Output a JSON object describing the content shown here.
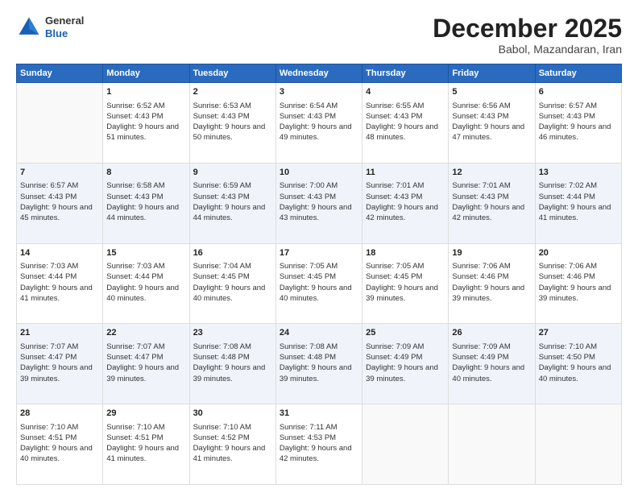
{
  "header": {
    "logo_line1": "General",
    "logo_line2": "Blue",
    "month": "December 2025",
    "location": "Babol, Mazandaran, Iran"
  },
  "weekdays": [
    "Sunday",
    "Monday",
    "Tuesday",
    "Wednesday",
    "Thursday",
    "Friday",
    "Saturday"
  ],
  "weeks": [
    [
      {
        "day": "",
        "sunrise": "",
        "sunset": "",
        "daylight": ""
      },
      {
        "day": "1",
        "sunrise": "Sunrise: 6:52 AM",
        "sunset": "Sunset: 4:43 PM",
        "daylight": "Daylight: 9 hours and 51 minutes."
      },
      {
        "day": "2",
        "sunrise": "Sunrise: 6:53 AM",
        "sunset": "Sunset: 4:43 PM",
        "daylight": "Daylight: 9 hours and 50 minutes."
      },
      {
        "day": "3",
        "sunrise": "Sunrise: 6:54 AM",
        "sunset": "Sunset: 4:43 PM",
        "daylight": "Daylight: 9 hours and 49 minutes."
      },
      {
        "day": "4",
        "sunrise": "Sunrise: 6:55 AM",
        "sunset": "Sunset: 4:43 PM",
        "daylight": "Daylight: 9 hours and 48 minutes."
      },
      {
        "day": "5",
        "sunrise": "Sunrise: 6:56 AM",
        "sunset": "Sunset: 4:43 PM",
        "daylight": "Daylight: 9 hours and 47 minutes."
      },
      {
        "day": "6",
        "sunrise": "Sunrise: 6:57 AM",
        "sunset": "Sunset: 4:43 PM",
        "daylight": "Daylight: 9 hours and 46 minutes."
      }
    ],
    [
      {
        "day": "7",
        "sunrise": "Sunrise: 6:57 AM",
        "sunset": "Sunset: 4:43 PM",
        "daylight": "Daylight: 9 hours and 45 minutes."
      },
      {
        "day": "8",
        "sunrise": "Sunrise: 6:58 AM",
        "sunset": "Sunset: 4:43 PM",
        "daylight": "Daylight: 9 hours and 44 minutes."
      },
      {
        "day": "9",
        "sunrise": "Sunrise: 6:59 AM",
        "sunset": "Sunset: 4:43 PM",
        "daylight": "Daylight: 9 hours and 44 minutes."
      },
      {
        "day": "10",
        "sunrise": "Sunrise: 7:00 AM",
        "sunset": "Sunset: 4:43 PM",
        "daylight": "Daylight: 9 hours and 43 minutes."
      },
      {
        "day": "11",
        "sunrise": "Sunrise: 7:01 AM",
        "sunset": "Sunset: 4:43 PM",
        "daylight": "Daylight: 9 hours and 42 minutes."
      },
      {
        "day": "12",
        "sunrise": "Sunrise: 7:01 AM",
        "sunset": "Sunset: 4:43 PM",
        "daylight": "Daylight: 9 hours and 42 minutes."
      },
      {
        "day": "13",
        "sunrise": "Sunrise: 7:02 AM",
        "sunset": "Sunset: 4:44 PM",
        "daylight": "Daylight: 9 hours and 41 minutes."
      }
    ],
    [
      {
        "day": "14",
        "sunrise": "Sunrise: 7:03 AM",
        "sunset": "Sunset: 4:44 PM",
        "daylight": "Daylight: 9 hours and 41 minutes."
      },
      {
        "day": "15",
        "sunrise": "Sunrise: 7:03 AM",
        "sunset": "Sunset: 4:44 PM",
        "daylight": "Daylight: 9 hours and 40 minutes."
      },
      {
        "day": "16",
        "sunrise": "Sunrise: 7:04 AM",
        "sunset": "Sunset: 4:45 PM",
        "daylight": "Daylight: 9 hours and 40 minutes."
      },
      {
        "day": "17",
        "sunrise": "Sunrise: 7:05 AM",
        "sunset": "Sunset: 4:45 PM",
        "daylight": "Daylight: 9 hours and 40 minutes."
      },
      {
        "day": "18",
        "sunrise": "Sunrise: 7:05 AM",
        "sunset": "Sunset: 4:45 PM",
        "daylight": "Daylight: 9 hours and 39 minutes."
      },
      {
        "day": "19",
        "sunrise": "Sunrise: 7:06 AM",
        "sunset": "Sunset: 4:46 PM",
        "daylight": "Daylight: 9 hours and 39 minutes."
      },
      {
        "day": "20",
        "sunrise": "Sunrise: 7:06 AM",
        "sunset": "Sunset: 4:46 PM",
        "daylight": "Daylight: 9 hours and 39 minutes."
      }
    ],
    [
      {
        "day": "21",
        "sunrise": "Sunrise: 7:07 AM",
        "sunset": "Sunset: 4:47 PM",
        "daylight": "Daylight: 9 hours and 39 minutes."
      },
      {
        "day": "22",
        "sunrise": "Sunrise: 7:07 AM",
        "sunset": "Sunset: 4:47 PM",
        "daylight": "Daylight: 9 hours and 39 minutes."
      },
      {
        "day": "23",
        "sunrise": "Sunrise: 7:08 AM",
        "sunset": "Sunset: 4:48 PM",
        "daylight": "Daylight: 9 hours and 39 minutes."
      },
      {
        "day": "24",
        "sunrise": "Sunrise: 7:08 AM",
        "sunset": "Sunset: 4:48 PM",
        "daylight": "Daylight: 9 hours and 39 minutes."
      },
      {
        "day": "25",
        "sunrise": "Sunrise: 7:09 AM",
        "sunset": "Sunset: 4:49 PM",
        "daylight": "Daylight: 9 hours and 39 minutes."
      },
      {
        "day": "26",
        "sunrise": "Sunrise: 7:09 AM",
        "sunset": "Sunset: 4:49 PM",
        "daylight": "Daylight: 9 hours and 40 minutes."
      },
      {
        "day": "27",
        "sunrise": "Sunrise: 7:10 AM",
        "sunset": "Sunset: 4:50 PM",
        "daylight": "Daylight: 9 hours and 40 minutes."
      }
    ],
    [
      {
        "day": "28",
        "sunrise": "Sunrise: 7:10 AM",
        "sunset": "Sunset: 4:51 PM",
        "daylight": "Daylight: 9 hours and 40 minutes."
      },
      {
        "day": "29",
        "sunrise": "Sunrise: 7:10 AM",
        "sunset": "Sunset: 4:51 PM",
        "daylight": "Daylight: 9 hours and 41 minutes."
      },
      {
        "day": "30",
        "sunrise": "Sunrise: 7:10 AM",
        "sunset": "Sunset: 4:52 PM",
        "daylight": "Daylight: 9 hours and 41 minutes."
      },
      {
        "day": "31",
        "sunrise": "Sunrise: 7:11 AM",
        "sunset": "Sunset: 4:53 PM",
        "daylight": "Daylight: 9 hours and 42 minutes."
      },
      {
        "day": "",
        "sunrise": "",
        "sunset": "",
        "daylight": ""
      },
      {
        "day": "",
        "sunrise": "",
        "sunset": "",
        "daylight": ""
      },
      {
        "day": "",
        "sunrise": "",
        "sunset": "",
        "daylight": ""
      }
    ]
  ]
}
